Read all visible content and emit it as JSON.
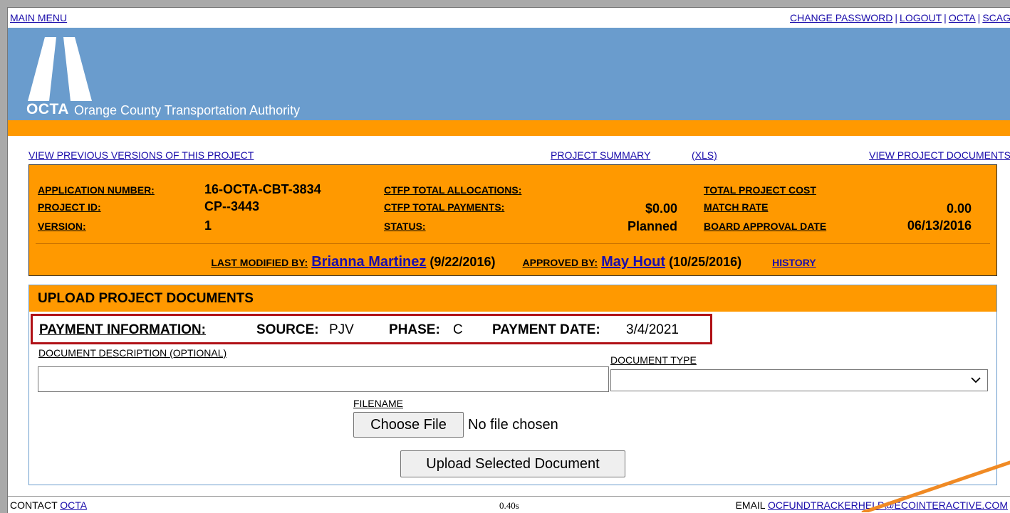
{
  "top_links": {
    "main_menu": "MAIN MENU",
    "change_password": "CHANGE PASSWORD",
    "logout": "LOGOUT",
    "octa": "OCTA",
    "scag": "SCAG",
    "separator": "|"
  },
  "banner": {
    "logo_word": "OCTA",
    "org_name": "Orange County Transportation Authority"
  },
  "nav": {
    "previous_versions": "VIEW PREVIOUS VERSIONS OF THIS PROJECT",
    "project_summary": "PROJECT SUMMARY",
    "xls": "(XLS)",
    "view_documents": "VIEW PROJECT DOCUMENTS"
  },
  "project": {
    "application_number_label": "APPLICATION NUMBER:",
    "application_number": "16-OCTA-CBT-3834",
    "project_id_label": "PROJECT ID:",
    "project_id": "CP--3443",
    "version_label": "VERSION:",
    "version": "1",
    "ctfp_total_allocations_label": "CTFP TOTAL ALLOCATIONS:",
    "ctfp_total_allocations": "",
    "ctfp_total_payments_label": "CTFP TOTAL PAYMENTS:",
    "ctfp_total_payments": "$0.00",
    "status_label": "STATUS:",
    "status": "Planned",
    "total_project_cost_label": "TOTAL PROJECT COST",
    "total_project_cost": "",
    "match_rate_label": "MATCH RATE",
    "match_rate": "0.00",
    "board_approval_date_label": "BOARD APPROVAL DATE",
    "board_approval_date": "06/13/2016",
    "last_modified_label": "LAST MODIFIED BY:",
    "last_modified_name": "Brianna Martinez",
    "last_modified_date": "(9/22/2016)",
    "approved_by_label": "APPROVED BY:",
    "approved_by_name": "May Hout",
    "approved_by_date": "(10/25/2016)",
    "history": "HISTORY"
  },
  "upload": {
    "title": "UPLOAD PROJECT DOCUMENTS",
    "payment_information_label": "PAYMENT INFORMATION:",
    "source_label": "SOURCE:",
    "source": "PJV",
    "phase_label": "PHASE:",
    "phase": "C",
    "payment_date_label": "PAYMENT DATE:",
    "payment_date": "3/4/2021",
    "document_description_label": "DOCUMENT DESCRIPTION (OPTIONAL)",
    "document_description_value": "",
    "document_type_label": "DOCUMENT TYPE",
    "document_type_value": "",
    "filename_label": "FILENAME",
    "choose_file": "Choose File",
    "no_file": "No file chosen",
    "upload_button": "Upload Selected Document"
  },
  "footer": {
    "contact_label": "CONTACT",
    "contact_link": "OCTA",
    "timing": "0.40s",
    "email_label": "EMAIL",
    "email": "OCFUNDTRACKERHELP@ECOINTERACTIVE.COM"
  },
  "colors": {
    "banner_blue": "#6a9ccd",
    "orange": "#ff9900",
    "highlight_red": "#b01116",
    "link_blue": "#1a0dab",
    "annotation_arrow": "#f08a24"
  },
  "icons": [
    "octa-logo-icon",
    "chevron-down-icon",
    "annotation-arrow"
  ]
}
